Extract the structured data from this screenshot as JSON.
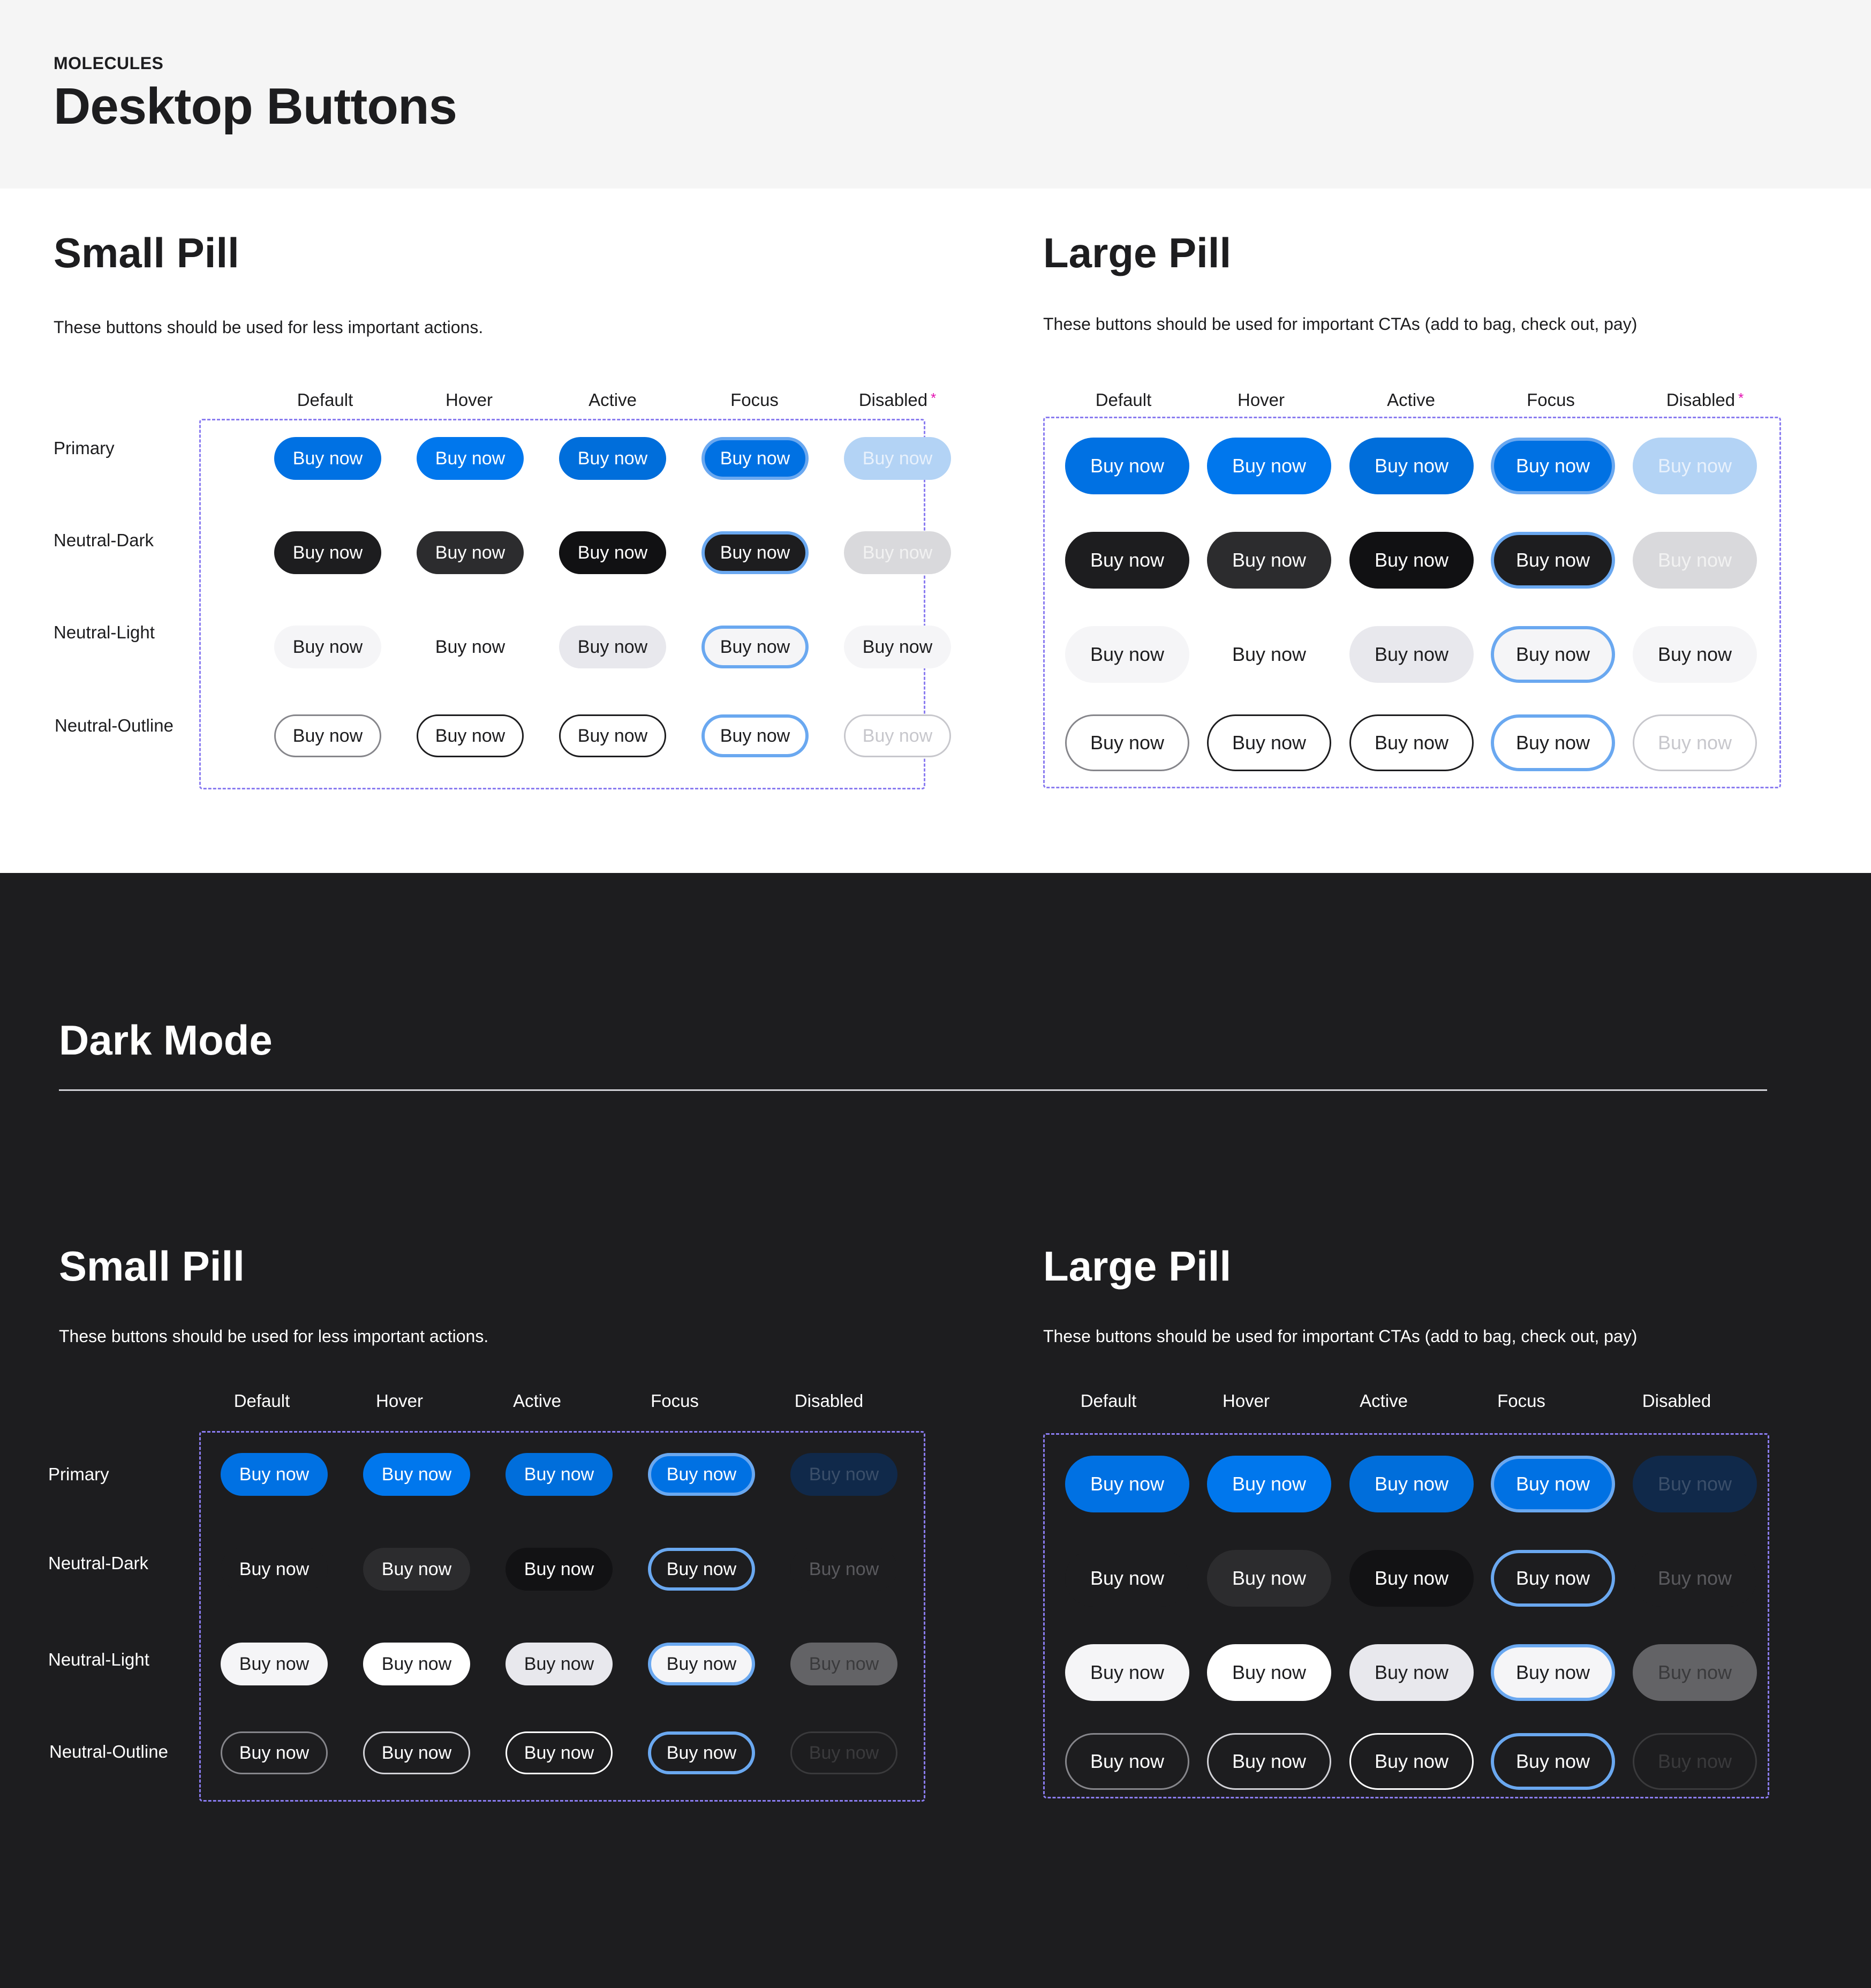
{
  "header": {
    "eyebrow": "MOLECULES",
    "title": "Desktop Buttons"
  },
  "dark_mode": {
    "title": "Dark Mode"
  },
  "columns_light": [
    "Default",
    "Hover",
    "Active",
    "Focus",
    "Disabled"
  ],
  "columns_dark": [
    "Default",
    "Hover",
    "Active",
    "Focus",
    "Disabled"
  ],
  "rows": [
    "Primary",
    "Neutral-Dark",
    "Neutral-Light",
    "Neutral-Outline"
  ],
  "button_label": "Buy now",
  "disabled_marker": "*",
  "sections": {
    "light_small": {
      "title": "Small Pill",
      "desc": "These buttons should be used for less important actions."
    },
    "light_large": {
      "title": "Large Pill",
      "desc": "These buttons should be used for important CTAs (add to bag, check out, pay)"
    },
    "dark_small": {
      "title": "Small Pill",
      "desc": "These buttons should be used for less important actions."
    },
    "dark_large": {
      "title": "Large Pill",
      "desc": "These buttons should be used for important CTAs (add to bag, check out, pay)"
    }
  },
  "colors": {
    "accent_blue": "#0071e3",
    "focus_ring": "#6aa8f0",
    "grid_outline": "#8a7cf0",
    "disabled_marker": "#e30fb0",
    "dark_bg": "#1d1d1f"
  },
  "styles": {
    "light": [
      [
        {
          "bg": "#0071e3",
          "fg": "#ffffff",
          "border": "none"
        },
        {
          "bg": "#0077ed",
          "fg": "#ffffff",
          "border": "none"
        },
        {
          "bg": "#006edb",
          "fg": "#ffffff",
          "border": "none"
        },
        {
          "bg": "#0071e3",
          "fg": "#ffffff",
          "border": "#6aa8f0",
          "bw": 6
        },
        {
          "bg": "#b3d3f5",
          "fg": "#e8f1fc",
          "border": "none"
        }
      ],
      [
        {
          "bg": "#1d1d1f",
          "fg": "#ffffff",
          "border": "none"
        },
        {
          "bg": "#2c2c2e",
          "fg": "#ffffff",
          "border": "none"
        },
        {
          "bg": "#111113",
          "fg": "#ffffff",
          "border": "none"
        },
        {
          "bg": "#1d1d1f",
          "fg": "#ffffff",
          "border": "#6aa8f0",
          "bw": 6
        },
        {
          "bg": "#d9d9dc",
          "fg": "#f2f2f2",
          "border": "none"
        }
      ],
      [
        {
          "bg": "#f5f5f7",
          "fg": "#1d1d1f",
          "border": "none"
        },
        {
          "bg": "#ffffff",
          "fg": "#1d1d1f",
          "border": "none"
        },
        {
          "bg": "#e8e8ed",
          "fg": "#1d1d1f",
          "border": "none"
        },
        {
          "bg": "#f5f5f7",
          "fg": "#1d1d1f",
          "border": "#6aa8f0",
          "bw": 6
        },
        {
          "bg": "#f5f5f7",
          "fg": "#1d1d1f",
          "border": "none"
        }
      ],
      [
        {
          "bg": "#ffffff",
          "fg": "#1d1d1f",
          "border": "#86868b",
          "bw": 3
        },
        {
          "bg": "#ffffff",
          "fg": "#1d1d1f",
          "border": "#1d1d1f",
          "bw": 3
        },
        {
          "bg": "#ffffff",
          "fg": "#1d1d1f",
          "border": "#1d1d1f",
          "bw": 3
        },
        {
          "bg": "#ffffff",
          "fg": "#1d1d1f",
          "border": "#6aa8f0",
          "bw": 6
        },
        {
          "bg": "#ffffff",
          "fg": "#c7c7cc",
          "border": "#c7c7cc",
          "bw": 3
        }
      ]
    ],
    "dark": [
      [
        {
          "bg": "#0071e3",
          "fg": "#ffffff",
          "border": "none"
        },
        {
          "bg": "#0077ed",
          "fg": "#ffffff",
          "border": "none"
        },
        {
          "bg": "#006edb",
          "fg": "#ffffff",
          "border": "none"
        },
        {
          "bg": "#0071e3",
          "fg": "#ffffff",
          "border": "#6aa8f0",
          "bw": 6
        },
        {
          "bg": "#10294a",
          "fg": "#3b4f6a",
          "border": "none"
        }
      ],
      [
        {
          "bg": "#1d1d1f",
          "fg": "#ffffff",
          "border": "none"
        },
        {
          "bg": "#2c2c2e",
          "fg": "#ffffff",
          "border": "none"
        },
        {
          "bg": "#121214",
          "fg": "#ffffff",
          "border": "none"
        },
        {
          "bg": "#1d1d1f",
          "fg": "#ffffff",
          "border": "#6aa8f0",
          "bw": 6
        },
        {
          "bg": "#1d1d1f",
          "fg": "#5a5a5e",
          "border": "none"
        }
      ],
      [
        {
          "bg": "#f5f5f7",
          "fg": "#1d1d1f",
          "border": "none"
        },
        {
          "bg": "#ffffff",
          "fg": "#1d1d1f",
          "border": "none"
        },
        {
          "bg": "#e8e8ed",
          "fg": "#1d1d1f",
          "border": "none"
        },
        {
          "bg": "#f5f5f7",
          "fg": "#1d1d1f",
          "border": "#6aa8f0",
          "bw": 6
        },
        {
          "bg": "#636366",
          "fg": "#3a3a3c",
          "border": "none"
        }
      ],
      [
        {
          "bg": "#1d1d1f",
          "fg": "#ffffff",
          "border": "#86868b",
          "bw": 3
        },
        {
          "bg": "#1d1d1f",
          "fg": "#ffffff",
          "border": "#d2d2d7",
          "bw": 3
        },
        {
          "bg": "#1d1d1f",
          "fg": "#ffffff",
          "border": "#ffffff",
          "bw": 3
        },
        {
          "bg": "#1d1d1f",
          "fg": "#ffffff",
          "border": "#6aa8f0",
          "bw": 6
        },
        {
          "bg": "#1d1d1f",
          "fg": "#3a3a3c",
          "border": "#3a3a3c",
          "bw": 3
        }
      ]
    ]
  }
}
